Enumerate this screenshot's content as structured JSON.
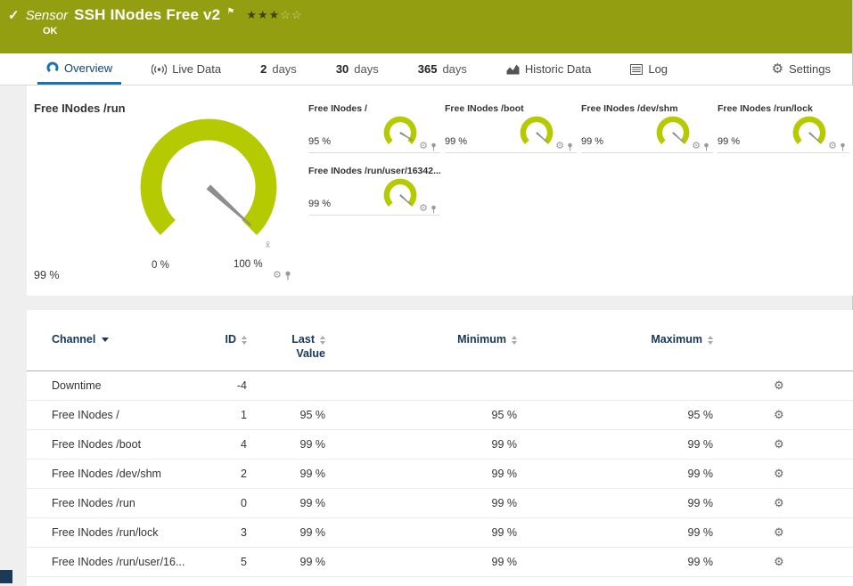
{
  "header": {
    "status_icon": "✓",
    "type_label": "Sensor",
    "title": "SSH INodes Free v2",
    "flag_icon": "⚑",
    "status": "OK",
    "stars_filled": "★★★",
    "stars_empty": "☆☆"
  },
  "tabs": [
    {
      "label": "Overview"
    },
    {
      "label": "Live Data"
    },
    {
      "num": "2",
      "label": "days"
    },
    {
      "num": "30",
      "label": "days"
    },
    {
      "num": "365",
      "label": "days"
    },
    {
      "label": "Historic Data"
    },
    {
      "label": "Log"
    },
    {
      "label": "Settings",
      "icon": "⚙"
    }
  ],
  "gauges": {
    "primary": {
      "title": "Free INodes /run",
      "value": 99,
      "value_label": "99 %",
      "min_label": "0 %",
      "max_label": "100 %",
      "mean_marker": "x̄"
    },
    "small": [
      {
        "title": "Free INodes /",
        "value": 95,
        "value_label": "95 %"
      },
      {
        "title": "Free INodes /boot",
        "value": 99,
        "value_label": "99 %"
      },
      {
        "title": "Free INodes /dev/shm",
        "value": 99,
        "value_label": "99 %"
      },
      {
        "title": "Free INodes /run/lock",
        "value": 99,
        "value_label": "99 %"
      },
      {
        "title": "Free INodes /run/user/16342...",
        "value": 99,
        "value_label": "99 %"
      }
    ],
    "gear_icon": "⚙"
  },
  "table": {
    "columns": {
      "channel": "Channel",
      "id": "ID",
      "last_line1": "Last",
      "last_line2": "Value",
      "minimum": "Minimum",
      "maximum": "Maximum"
    },
    "gear_icon": "⚙",
    "rows": [
      {
        "channel": "Downtime",
        "id": "-4",
        "last": "",
        "min": "",
        "max": ""
      },
      {
        "channel": "Free INodes /",
        "id": "1",
        "last": "95 %",
        "min": "95 %",
        "max": "95 %"
      },
      {
        "channel": "Free INodes /boot",
        "id": "4",
        "last": "99 %",
        "min": "99 %",
        "max": "99 %"
      },
      {
        "channel": "Free INodes /dev/shm",
        "id": "2",
        "last": "99 %",
        "min": "99 %",
        "max": "99 %"
      },
      {
        "channel": "Free INodes /run",
        "id": "0",
        "last": "99 %",
        "min": "99 %",
        "max": "99 %"
      },
      {
        "channel": "Free INodes /run/lock",
        "id": "3",
        "last": "99 %",
        "min": "99 %",
        "max": "99 %"
      },
      {
        "channel": "Free INodes /run/user/16...",
        "id": "5",
        "last": "99 %",
        "min": "99 %",
        "max": "99 %"
      }
    ]
  },
  "colors": {
    "status_ok_bg": "#939f11",
    "gauge_green": "#b5ca00",
    "accent_blue": "#1a74b4",
    "header_navy": "#16375a"
  }
}
